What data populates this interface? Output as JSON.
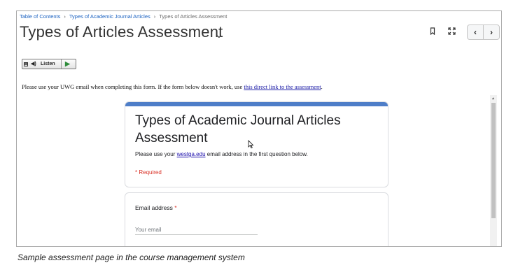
{
  "breadcrumb": {
    "items": [
      "Table of Contents",
      "Types of Academic Journal Articles",
      "Types of Articles Assessment"
    ],
    "separator": "›"
  },
  "header": {
    "title": "Types of Articles Assessment",
    "chevron": "⌄",
    "icons": [
      "bookmark-icon",
      "fullscreen-icon"
    ],
    "prev": "‹",
    "next": "›"
  },
  "listen": {
    "label": "Listen",
    "speaker": "◀)",
    "play": "▶"
  },
  "instructions": {
    "text": "Please use your UWG email when completing this form. If the form below doesn't work, use ",
    "link": "this direct link to the assessment",
    "end": "."
  },
  "form": {
    "accent_color": "#4e7ec8",
    "title": "Types of Academic Journal Articles Assessment",
    "desc_before": "Please use your ",
    "desc_link": "westga.edu",
    "desc_after": " email address in the first question below.",
    "required_note": "* Required",
    "email_label": "Email address",
    "required_star": "*",
    "email_placeholder": "Your email"
  },
  "caption": "Sample assessment page in the course management system"
}
